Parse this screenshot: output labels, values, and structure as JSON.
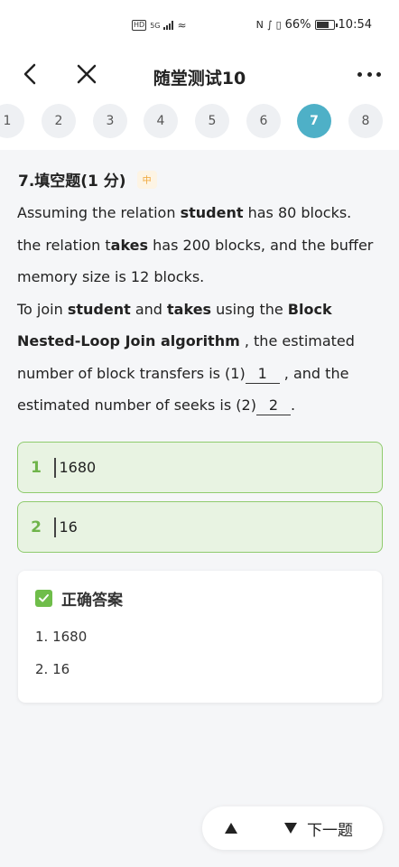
{
  "status_bar": {
    "network_badge": "HD",
    "network_type": "5G",
    "battery_percent": "66%",
    "battery_level": 0.66,
    "time": "10:54"
  },
  "navbar": {
    "title": "随堂测试10"
  },
  "question_nav": {
    "numbers": [
      "1",
      "2",
      "3",
      "4",
      "5",
      "6",
      "7",
      "8"
    ],
    "active_index": 6
  },
  "question": {
    "title": "7.填空题(1 分)",
    "difficulty": "中",
    "p1_a": "Assuming the relation ",
    "p1_b": "student",
    "p1_c": " has 80 blocks. the relation t",
    "p1_d": "akes",
    "p1_e": " has 200 blocks, and the buffer memory size is 12 blocks.",
    "p2_a": "To join ",
    "p2_b": "student",
    "p2_c": " and ",
    "p2_d": "takes",
    "p2_e": " using the ",
    "p2_f": "Block Nested-Loop Join algorithm",
    "p2_g": " , the estimated number of block transfers is (1)",
    "blank1": "1",
    "p2_h": " , and the estimated number of seeks is (2)",
    "blank2": "2",
    "p2_i": "."
  },
  "answers": [
    {
      "index": "1",
      "value": "1680"
    },
    {
      "index": "2",
      "value": "16"
    }
  ],
  "correct_answer": {
    "title": "正确答案",
    "items": [
      "1. 1680",
      "2. 16"
    ]
  },
  "bottom": {
    "next_label": "下一题"
  }
}
